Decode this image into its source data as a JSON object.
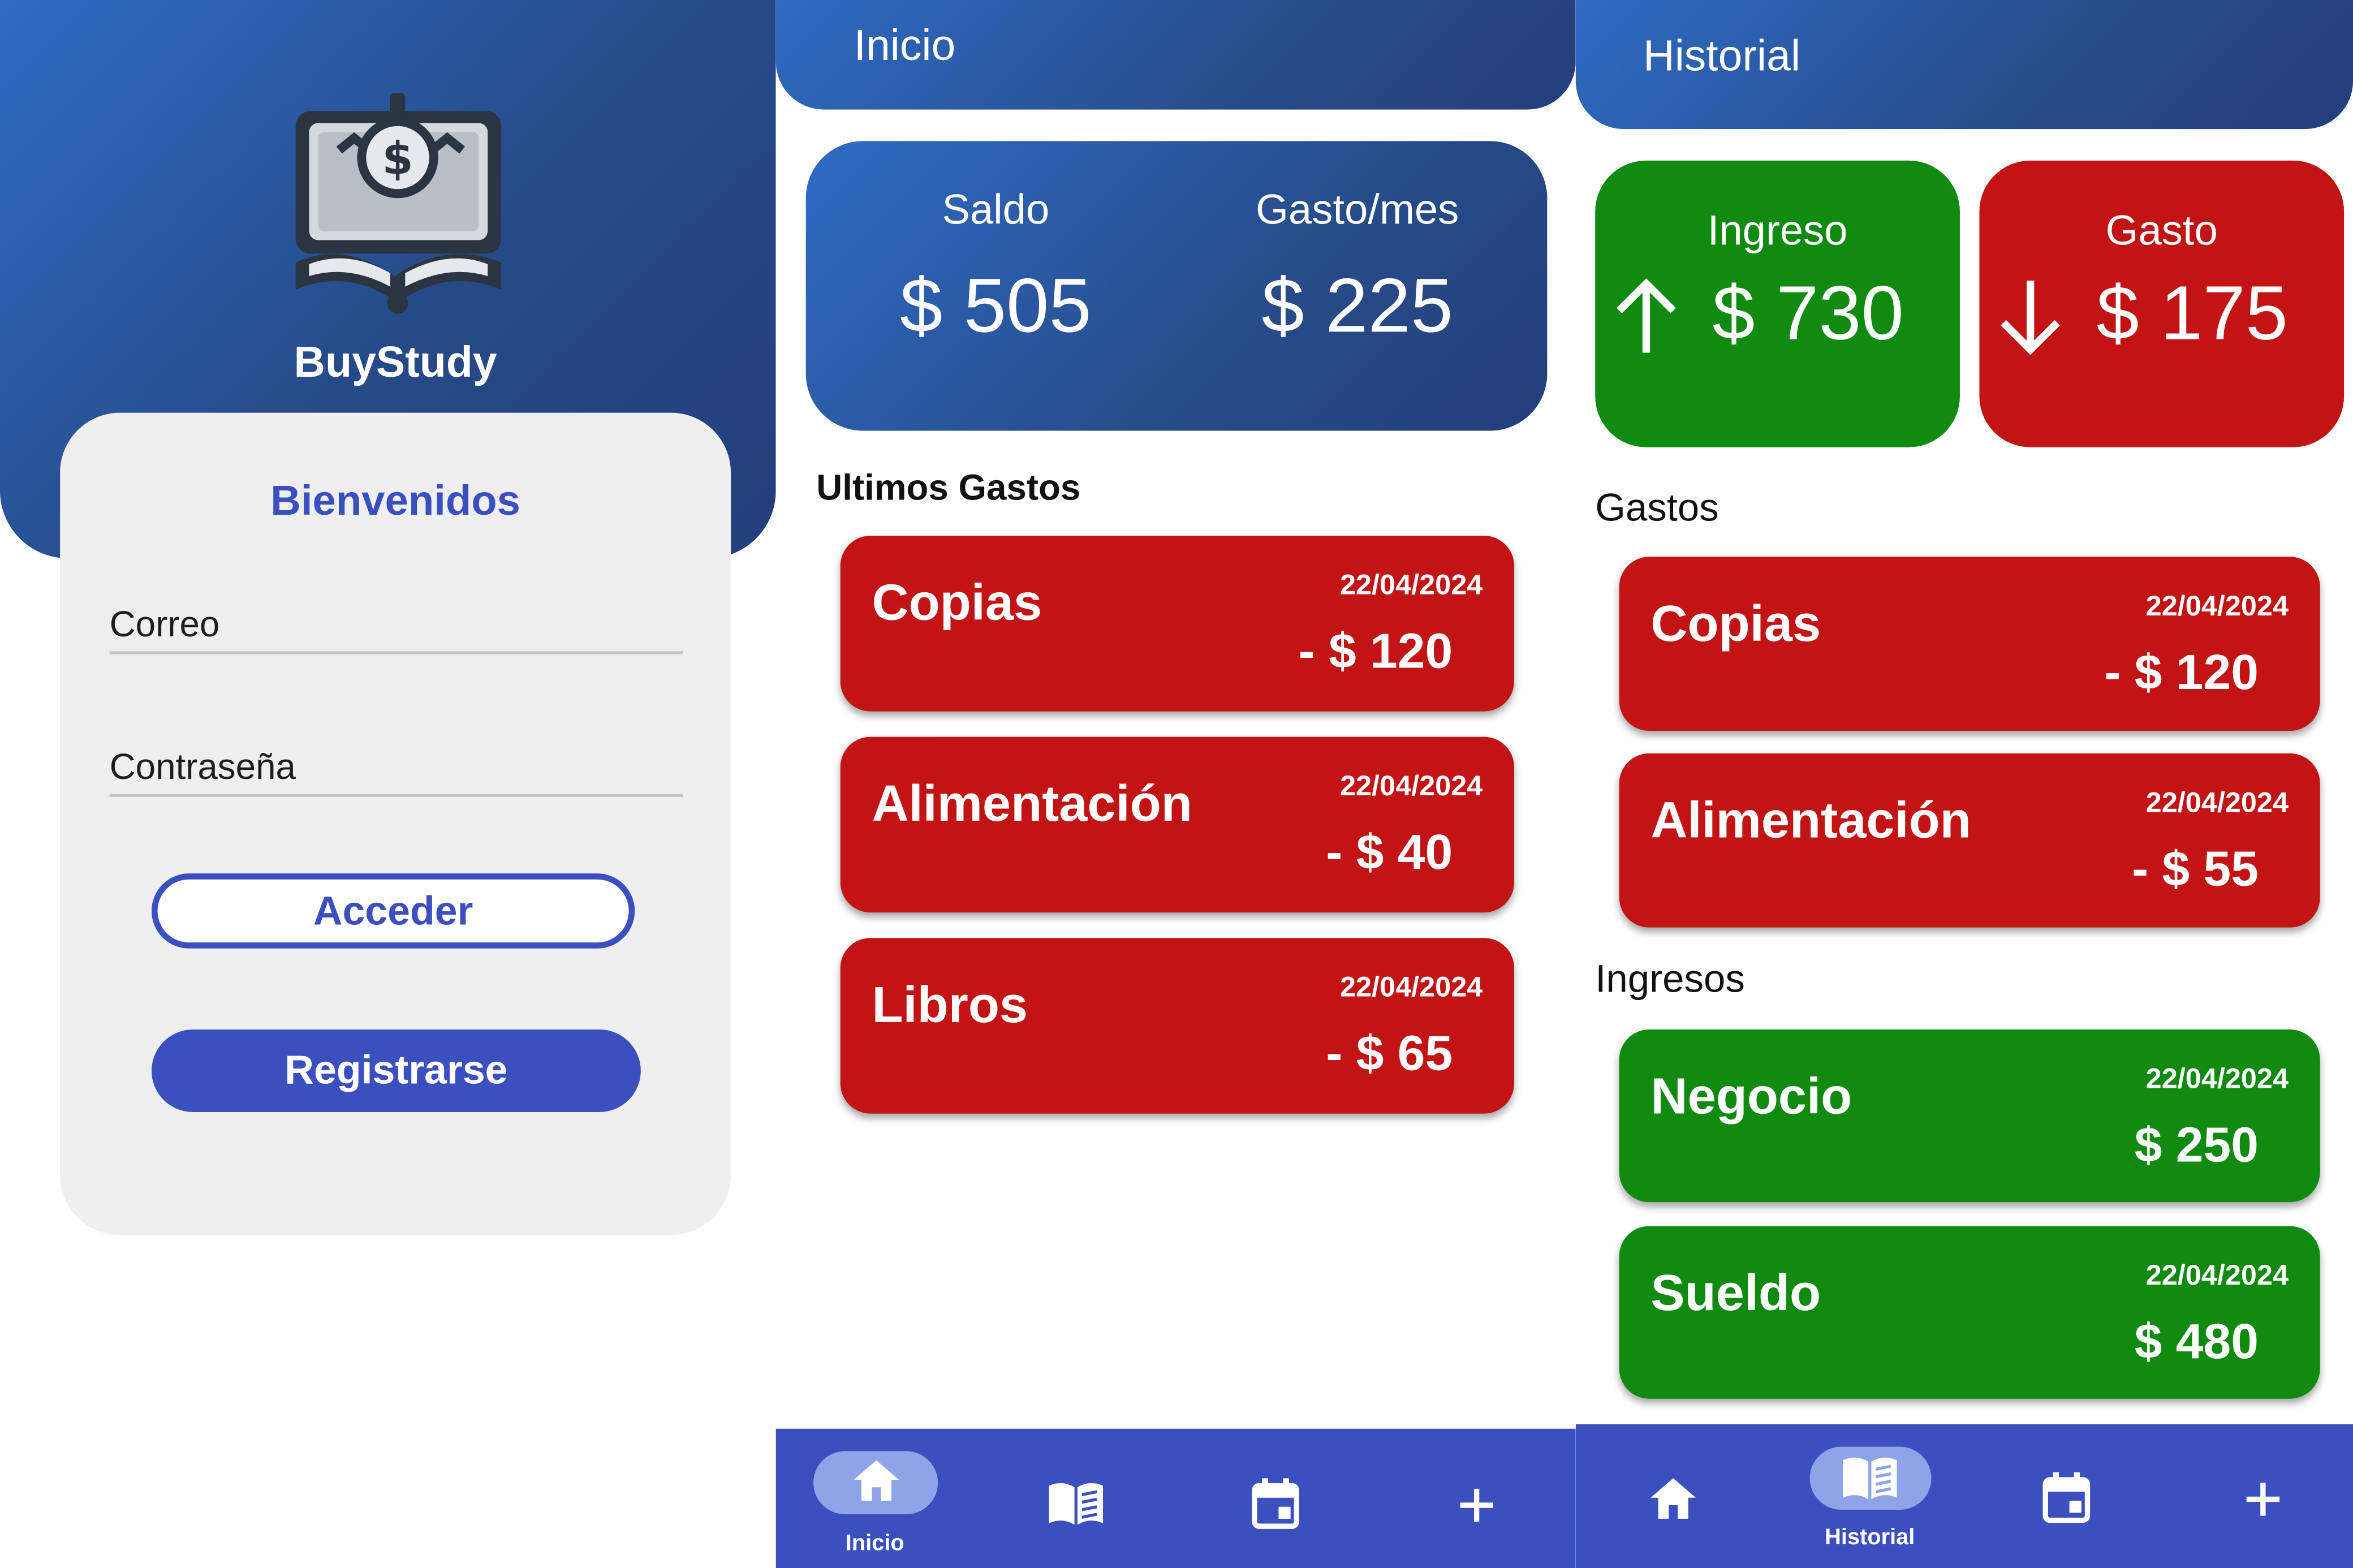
{
  "login": {
    "app_name": "BuyStudy",
    "logo_icon": "book-money-icon",
    "welcome": "Bienvenidos",
    "email_placeholder": "Correo",
    "password_placeholder": "Contraseña",
    "login_button": "Acceder",
    "register_button": "Registrarse"
  },
  "home": {
    "title": "Inicio",
    "summary": {
      "balance_label": "Saldo",
      "balance_value": "$ 505",
      "monthly_label": "Gasto/mes",
      "monthly_value": "$ 225"
    },
    "section_title": "Ultimos Gastos",
    "expenses": [
      {
        "name": "Copias",
        "date": "22/04/2024",
        "amount": "- $ 120"
      },
      {
        "name": "Alimentación",
        "date": "22/04/2024",
        "amount": "- $ 40"
      },
      {
        "name": "Libros",
        "date": "22/04/2024",
        "amount": "- $ 65"
      }
    ],
    "nav": {
      "home_label": "Inicio"
    }
  },
  "history": {
    "title": "Historial",
    "income_label": "Ingreso",
    "income_value": "$ 730",
    "expense_label": "Gasto",
    "expense_value": "$ 175",
    "expenses_title": "Gastos",
    "expenses": [
      {
        "name": "Copias",
        "date": "22/04/2024",
        "amount": "- $ 120"
      },
      {
        "name": "Alimentación",
        "date": "22/04/2024",
        "amount": "- $ 55"
      }
    ],
    "incomes_title": "Ingresos",
    "incomes": [
      {
        "name": "Negocio",
        "date": "22/04/2024",
        "amount": "$ 250"
      },
      {
        "name": "Sueldo",
        "date": "22/04/2024",
        "amount": "$ 480"
      }
    ],
    "nav": {
      "history_label": "Historial"
    }
  },
  "colors": {
    "primary": "#3b4fbf",
    "header_blue": "#264a87",
    "expense_red": "#c21414",
    "income_green": "#118a11",
    "nav_pill": "#8fa4e8"
  },
  "icons": [
    "home-icon",
    "book-icon",
    "calendar-icon",
    "plus-icon",
    "arrow-up-icon",
    "arrow-down-icon"
  ]
}
